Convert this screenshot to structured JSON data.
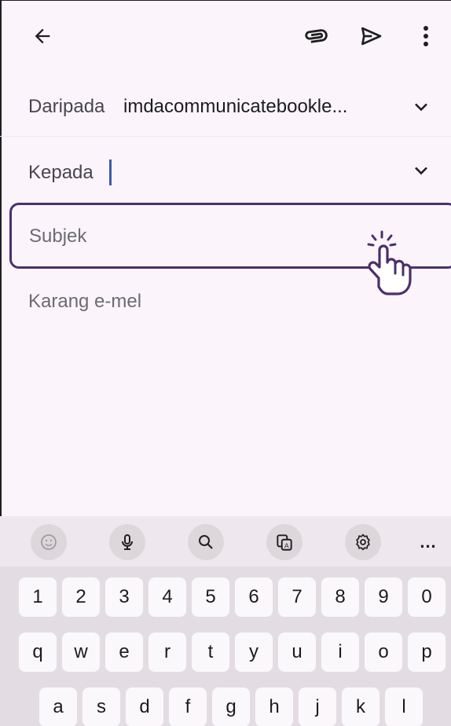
{
  "from": {
    "label": "Daripada",
    "value": "imdacommunicatebookle..."
  },
  "to": {
    "label": "Kepada"
  },
  "subject": {
    "placeholder": "Subjek"
  },
  "body": {
    "placeholder": "Karang e-mel"
  },
  "toolbar": {
    "icons": [
      "back-arrow-icon",
      "paperclip-icon",
      "send-icon",
      "more-vert-icon"
    ]
  },
  "keyboard": {
    "toolbar_icons": [
      "emoji-icon",
      "microphone-icon",
      "search-icon",
      "clipboard-translate-icon",
      "settings-icon"
    ],
    "more_label": "...",
    "row_numbers": [
      "1",
      "2",
      "3",
      "4",
      "5",
      "6",
      "7",
      "8",
      "9",
      "0"
    ],
    "row_top": [
      "q",
      "w",
      "e",
      "r",
      "t",
      "y",
      "u",
      "i",
      "o",
      "p"
    ],
    "row_home": [
      "a",
      "s",
      "d",
      "f",
      "g",
      "h",
      "j",
      "k",
      "l"
    ]
  },
  "colors": {
    "accent": "#4c2f6c",
    "caret": "#3b5bab",
    "background": "#fbf5fb"
  }
}
